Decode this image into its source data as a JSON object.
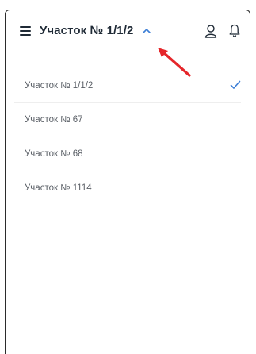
{
  "header": {
    "title": "Участок № 1/1/2",
    "menu_icon": "hamburger-menu-icon",
    "toggle_icon": "chevron-up-icon",
    "profile_icon": "user-icon",
    "notifications_icon": "bell-icon"
  },
  "list": {
    "items": [
      {
        "label": "Участок № 1/1/2",
        "selected": true
      },
      {
        "label": "Участок № 67",
        "selected": false
      },
      {
        "label": "Участок № 68",
        "selected": false
      },
      {
        "label": "Участок № 1114",
        "selected": false
      }
    ]
  },
  "colors": {
    "accent": "#3d7fd6",
    "title_text": "#1f2a36",
    "item_text": "#5a5f66",
    "divider": "#eeeeee",
    "annotation_arrow": "#e5262a"
  }
}
